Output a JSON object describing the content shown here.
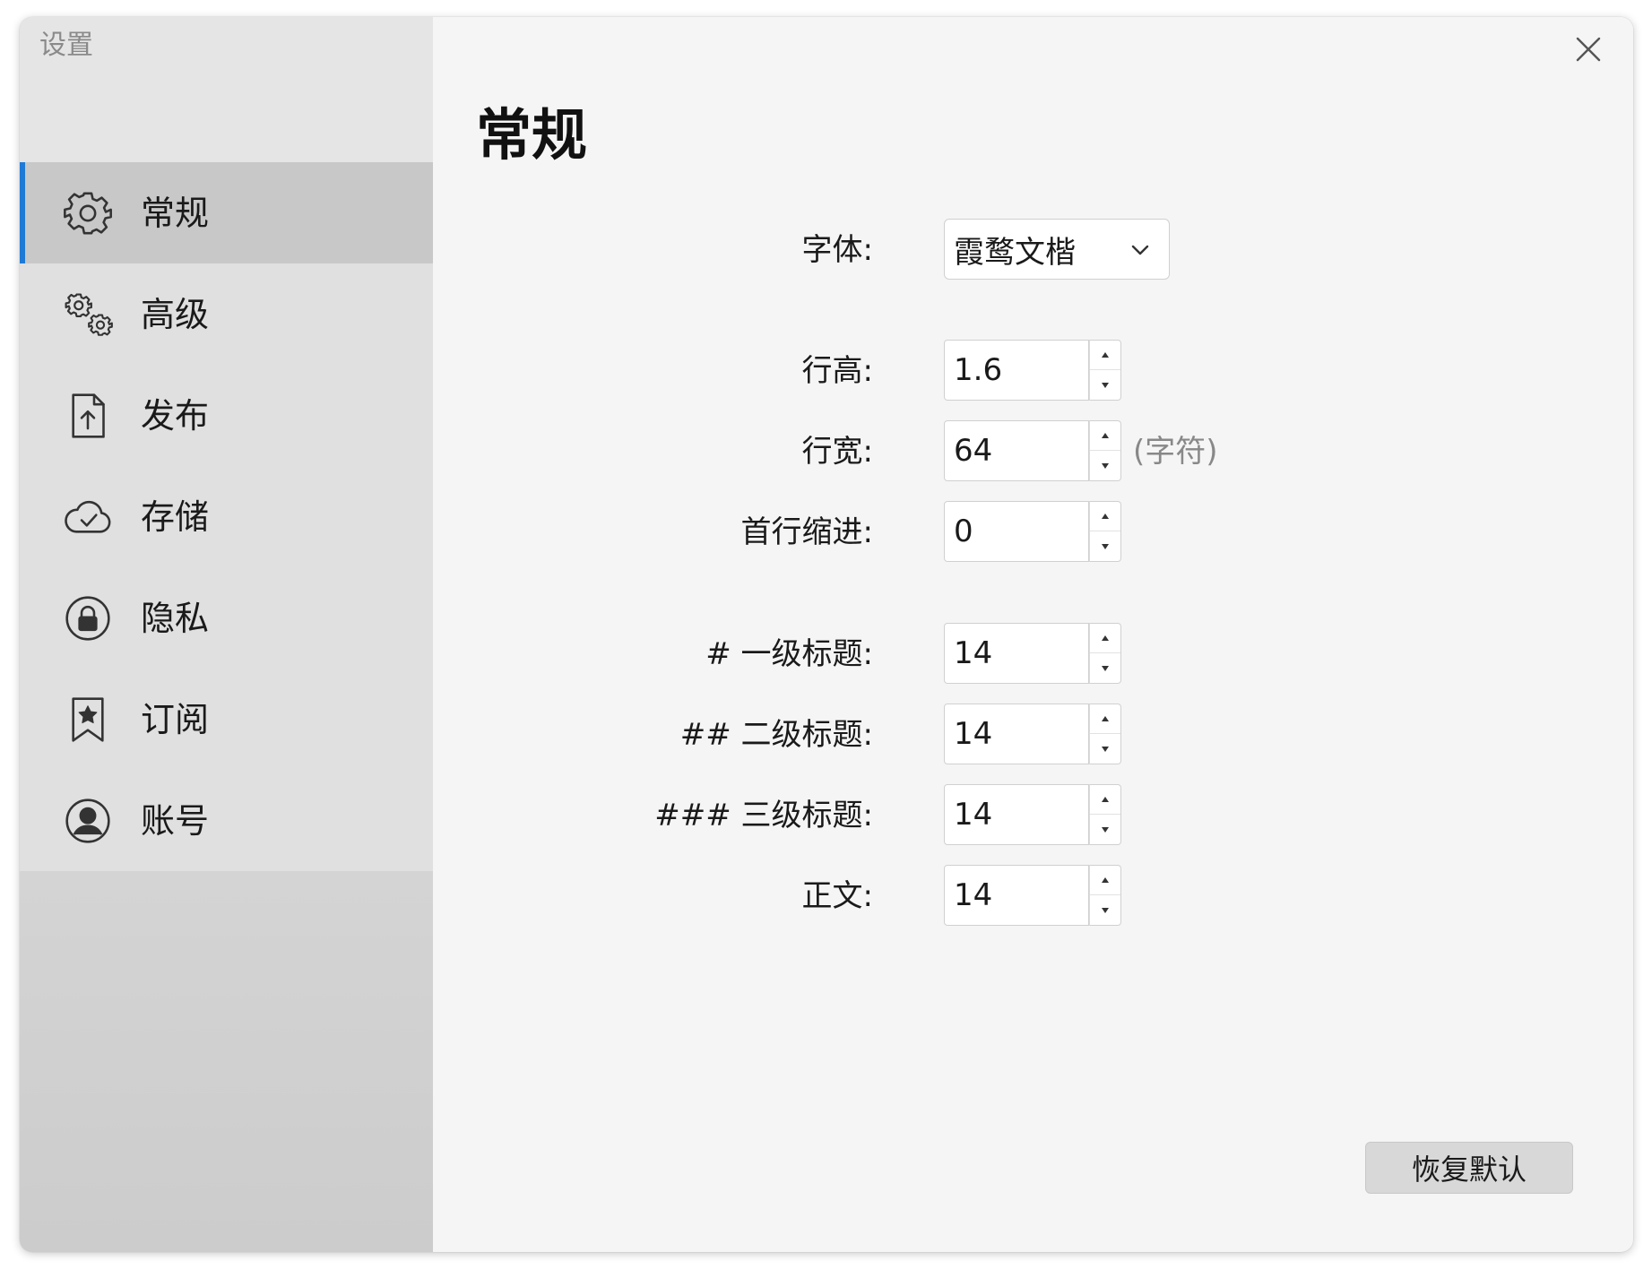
{
  "window": {
    "title": "设置"
  },
  "sidebar": {
    "items": [
      {
        "label": "常规",
        "icon": "gear-icon",
        "active": true
      },
      {
        "label": "高级",
        "icon": "gears-icon",
        "active": false
      },
      {
        "label": "发布",
        "icon": "upload-file-icon",
        "active": false
      },
      {
        "label": "存储",
        "icon": "cloud-check-icon",
        "active": false
      },
      {
        "label": "隐私",
        "icon": "lock-icon",
        "active": false
      },
      {
        "label": "订阅",
        "icon": "bookmark-star-icon",
        "active": false
      },
      {
        "label": "账号",
        "icon": "user-circle-icon",
        "active": false
      }
    ]
  },
  "main": {
    "title": "常规",
    "font": {
      "label": "字体:",
      "value": "霞鹜文楷"
    },
    "line_height": {
      "label": "行高:",
      "value": "1.6"
    },
    "line_width": {
      "label": "行宽:",
      "value": "64",
      "suffix": "(字符)"
    },
    "first_indent": {
      "label": "首行缩进:",
      "value": "0"
    },
    "h1": {
      "label": "# 一级标题:",
      "value": "14"
    },
    "h2": {
      "label": "## 二级标题:",
      "value": "14"
    },
    "h3": {
      "label": "### 三级标题:",
      "value": "14"
    },
    "body": {
      "label": "正文:",
      "value": "14"
    },
    "reset_label": "恢复默认"
  },
  "colors": {
    "accent": "#1f7ad6",
    "active_item_bg": "#c8c8c8"
  }
}
